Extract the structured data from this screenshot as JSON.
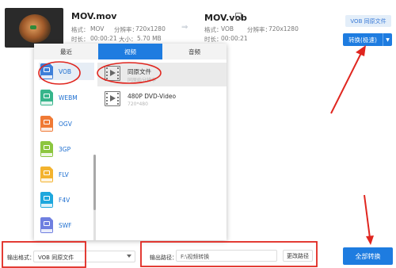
{
  "source": {
    "filename": "MOV.mov",
    "format_label": "格式：",
    "format": "MOV",
    "resolution_label": "分辨率：",
    "resolution": "720x1280",
    "duration_label": "时长：",
    "duration": "00:00:21",
    "size_label": "大小：",
    "size": "5.70 MB"
  },
  "target": {
    "filename": "MOV.vob",
    "format_label": "格式：",
    "format": "VOB",
    "resolution_label": "分辨率：",
    "resolution": "720x1280",
    "duration_label": "时长：",
    "duration": "00:00:21"
  },
  "actions": {
    "format_button": "VOB 同原文件",
    "convert_button": "转换(极速)",
    "convert_all_button": "全部转换"
  },
  "popup": {
    "tabs": [
      {
        "label": "最近",
        "active": false
      },
      {
        "label": "视频",
        "active": true
      },
      {
        "label": "音频",
        "active": false
      }
    ],
    "formats": [
      {
        "label": "VOB",
        "icon": "vob-file-icon",
        "color": "#3e7fd9",
        "selected": true
      },
      {
        "label": "WEBM",
        "icon": "webm-file-icon",
        "color": "#37b58b",
        "selected": false
      },
      {
        "label": "OGV",
        "icon": "ogv-file-icon",
        "color": "#f07a35",
        "selected": false
      },
      {
        "label": "3GP",
        "icon": "3gp-file-icon",
        "color": "#8cc63f",
        "selected": false
      },
      {
        "label": "FLV",
        "icon": "flv-file-icon",
        "color": "#f3b32f",
        "selected": false
      },
      {
        "label": "F4V",
        "icon": "f4v-file-icon",
        "color": "#1ea7dd",
        "selected": false
      },
      {
        "label": "SWF",
        "icon": "swf-file-icon",
        "color": "#6f7fe0",
        "selected": false
      }
    ],
    "options": [
      {
        "title": "同原文件",
        "subtitle": "同原始分辨率",
        "selected": true
      },
      {
        "title": "480P DVD-Video",
        "subtitle": "720*480",
        "selected": false
      }
    ]
  },
  "output": {
    "format_label": "输出格式：",
    "format_value": "VOB 同原文件",
    "path_label": "输出路径：",
    "path_value": "F:\\视频转换",
    "change_button": "更改路径"
  },
  "colors": {
    "accent": "#1e7ce0",
    "annotation": "#e0261f"
  }
}
